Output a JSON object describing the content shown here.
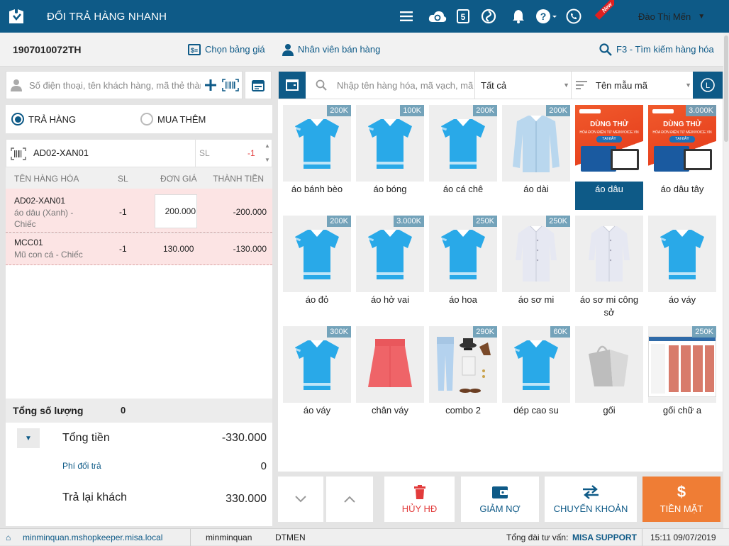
{
  "app": {
    "title": "ĐỔI TRẢ HÀNG NHANH",
    "user": "Đào Thị Mến",
    "new_badge": "New"
  },
  "subbar": {
    "invoice_no": "1907010072TH",
    "price_list": "Chọn bảng giá",
    "staff": "Nhân viên bán hàng",
    "search_hint": "F3 - Tìm kiếm hàng hóa"
  },
  "customer": {
    "placeholder": "Số điện thoại, tên khách hàng, mã thẻ thành viên"
  },
  "modes": {
    "return": "TRẢ HÀNG",
    "buy_more": "MUA THÊM"
  },
  "scan": {
    "code": "AD02-XAN01",
    "qty_label": "SL",
    "qty_value": "-1"
  },
  "table": {
    "headers": {
      "name": "TÊN HÀNG HÓA",
      "qty": "SL",
      "price": "ĐƠN GIÁ",
      "amount": "THÀNH TIỀN"
    },
    "rows": [
      {
        "code": "AD02-XAN01",
        "desc": "áo dâu (Xanh) - Chiếc",
        "qty": "-1",
        "price": "200.000",
        "amount": "-200.000"
      },
      {
        "code": "MCC01",
        "desc": "Mũ con cá - Chiếc",
        "qty": "-1",
        "price": "130.000",
        "amount": "-130.000"
      }
    ]
  },
  "totals": {
    "qty_label": "Tổng số lượng",
    "qty_value": "0",
    "total_label": "Tổng tiền",
    "total_value": "-330.000",
    "fee_label": "Phí đổi trả",
    "fee_value": "0",
    "refund_label": "Trả lại khách",
    "refund_value": "330.000"
  },
  "product_search": {
    "placeholder": "Nhập tên hàng hóa, mã vạch, mã",
    "category": "Tất cả",
    "sort": "Tên mẫu mã"
  },
  "products": [
    {
      "name": "áo bánh bèo",
      "price": "200K",
      "img": "shirt-icon"
    },
    {
      "name": "áo bóng",
      "price": "100K",
      "img": "shirt-icon"
    },
    {
      "name": "áo cá chê",
      "price": "200K",
      "img": "shirt-icon"
    },
    {
      "name": "áo dài",
      "price": "200K",
      "img": "longshirt-icon"
    },
    {
      "name": "áo dâu",
      "price": "",
      "img": "promo-banner",
      "selected": true
    },
    {
      "name": "áo dâu tây",
      "price": "3.000K",
      "img": "promo-banner"
    },
    {
      "name": "áo đỏ",
      "price": "200K",
      "img": "shirt-icon"
    },
    {
      "name": "áo hở vai",
      "price": "3.000K",
      "img": "shirt-icon"
    },
    {
      "name": "áo hoa",
      "price": "250K",
      "img": "shirt-icon"
    },
    {
      "name": "áo sơ mi",
      "price": "250K",
      "img": "dress-shirt-icon"
    },
    {
      "name": "áo sơ mi công sở",
      "price": "",
      "img": "dress-shirt-icon"
    },
    {
      "name": "áo váy",
      "price": "",
      "img": "shirt-icon"
    },
    {
      "name": "áo váy",
      "price": "300K",
      "img": "shirt-icon"
    },
    {
      "name": "chân váy",
      "price": "",
      "img": "skirt-icon"
    },
    {
      "name": "combo 2",
      "price": "290K",
      "img": "outfit-icon"
    },
    {
      "name": "dép cao su",
      "price": "60K",
      "img": "shirt-icon"
    },
    {
      "name": "gối",
      "price": "",
      "img": "bag-placeholder-icon"
    },
    {
      "name": "gối chữ a",
      "price": "250K",
      "img": "screenshot-thumb"
    }
  ],
  "promo": {
    "line1": "DÙNG THỬ",
    "line2": "HÓA ĐƠN ĐIỆN TỬ MEINVOICE.VN",
    "line3": "TẠI ĐÂY"
  },
  "actions": {
    "cancel": "HỦY HĐ",
    "discount": "GIẢM NỢ",
    "transfer": "CHUYỂN KHOẢN",
    "cash": "TIỀN MẶT"
  },
  "colors": {
    "brand": "#0e5a87",
    "shirt": "#29a9e8",
    "cash": "#ef7d35",
    "danger": "#e23b3b"
  },
  "footer": {
    "domain": "minminquan.mshopkeeper.misa.local",
    "account": "minminquan",
    "staff_code": "DTMEN",
    "support_label": "Tổng đài tư vấn:",
    "support": "MISA SUPPORT",
    "datetime": "15:11 09/07/2019"
  }
}
